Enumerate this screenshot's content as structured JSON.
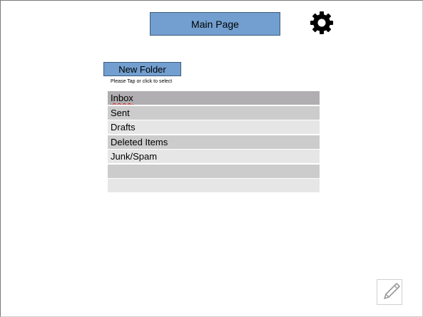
{
  "header": {
    "main_page_label": "Main Page",
    "settings_icon": "gear-icon"
  },
  "toolbar": {
    "new_folder_label": "New Folder"
  },
  "hint": "Please Tap or click to select",
  "folders": [
    {
      "label": "Inbox",
      "shade": 0,
      "spellcheck": true
    },
    {
      "label": "Sent",
      "shade": 1
    },
    {
      "label": "Drafts",
      "shade": 2
    },
    {
      "label": "Deleted Items",
      "shade": 1
    },
    {
      "label": "Junk/Spam",
      "shade": 2
    },
    {
      "label": "",
      "shade": 1
    },
    {
      "label": "",
      "shade": 2
    }
  ],
  "compose_icon": "pencil-icon",
  "colors": {
    "button_fill": "#729fcf",
    "button_border": "#3c5a7d"
  }
}
